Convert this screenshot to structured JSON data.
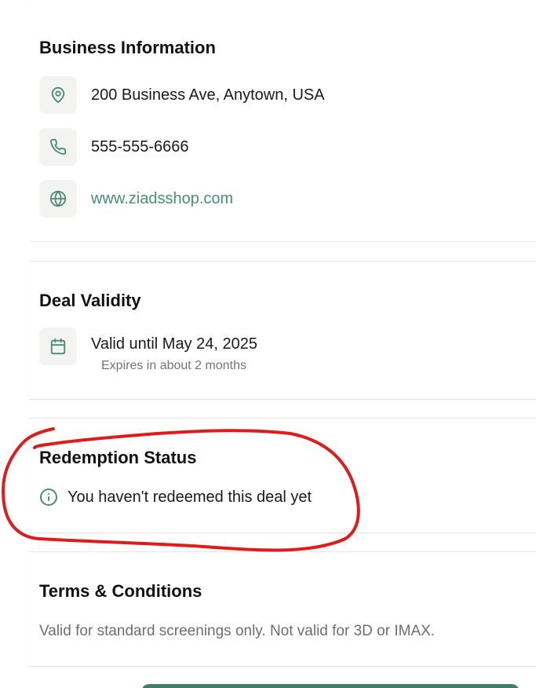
{
  "business_info": {
    "title": "Business Information",
    "address": "200 Business Ave, Anytown, USA",
    "phone": "555-555-6666",
    "website": "www.ziadsshop.com",
    "icons": [
      "map-pin-icon",
      "phone-icon",
      "globe-icon"
    ]
  },
  "deal_validity": {
    "title": "Deal Validity",
    "valid_until": "Valid until May 24, 2025",
    "expires_note": "Expires in about 2 months",
    "icon": "calendar-icon"
  },
  "redemption_status": {
    "title": "Redemption Status",
    "message": "You haven't redeemed this deal yet",
    "icon": "info-icon"
  },
  "terms": {
    "title": "Terms & Conditions",
    "text": "Valid for standard screenings only. Not valid for 3D or IMAX."
  },
  "colors": {
    "accent": "#4a8c79",
    "icon_bg": "#f3f4f2",
    "annotation": "#e01b1b",
    "button": "#3f7d6d"
  }
}
